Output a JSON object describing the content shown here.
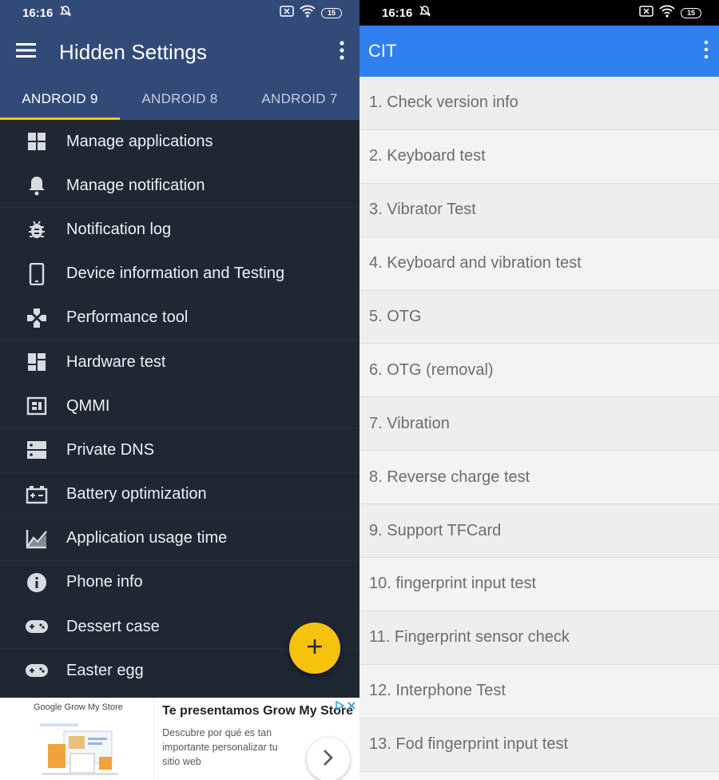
{
  "left": {
    "status": {
      "time": "16:16",
      "battery": "15"
    },
    "appbar": {
      "title": "Hidden Settings"
    },
    "tabs": [
      {
        "label": "ANDROID 9",
        "active": true
      },
      {
        "label": "ANDROID 8",
        "active": false
      },
      {
        "label": "ANDROID 7",
        "active": false
      }
    ],
    "menu": [
      {
        "label": "Manage applications",
        "icon": "grid-icon"
      },
      {
        "label": "Manage notification",
        "icon": "bell-icon"
      },
      {
        "label": "Notification log",
        "icon": "bug-icon"
      },
      {
        "label": "Device information and Testing",
        "icon": "phone-icon"
      },
      {
        "label": "Performance tool",
        "icon": "gamepad-cross-icon"
      },
      {
        "label": "Hardware test",
        "icon": "dashboard-icon"
      },
      {
        "label": "QMMI",
        "icon": "chip-icon"
      },
      {
        "label": "Private DNS",
        "icon": "server-icon"
      },
      {
        "label": "Battery optimization",
        "icon": "battery-plus-icon"
      },
      {
        "label": "Application usage time",
        "icon": "chart-icon"
      },
      {
        "label": "Phone info",
        "icon": "info-icon"
      },
      {
        "label": "Dessert case",
        "icon": "controller-icon"
      },
      {
        "label": "Easter egg",
        "icon": "controller-icon"
      }
    ],
    "fab": {
      "icon": "plus-icon",
      "color": "#f7c20e"
    },
    "ad": {
      "brand": "Google Grow My Store",
      "title": "Te presentamos Grow My Store",
      "description": "Descubre por qué es tan importante personalizar tu sitio web"
    }
  },
  "right": {
    "status": {
      "time": "16:16",
      "battery": "15"
    },
    "appbar": {
      "title": "CIT"
    },
    "items": [
      "1. Check version info",
      "2. Keyboard test",
      "3. Vibrator Test",
      "4. Keyboard and vibration test",
      "5. OTG",
      "6. OTG (removal)",
      "7. Vibration",
      "8. Reverse charge test",
      "9. Support TFCard",
      "10. fingerprint input test",
      "11. Fingerprint sensor check",
      "12. Interphone Test",
      "13. Fod fingerprint input test"
    ]
  },
  "colors": {
    "left_header": "#324a78",
    "left_bg": "#1f2733",
    "tab_indicator": "#f6c414",
    "right_header": "#2f80ee"
  }
}
